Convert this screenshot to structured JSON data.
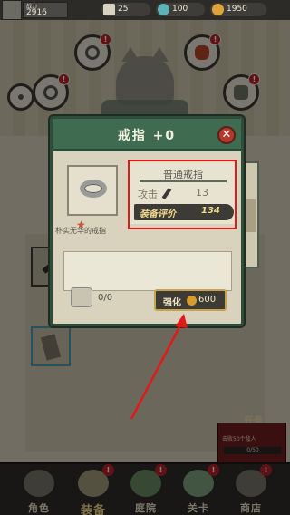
{
  "topbar": {
    "power_label": "战力",
    "power_value": "2916",
    "resource_1": "25",
    "resource_2": "100",
    "resource_3": "1950"
  },
  "slots": {
    "badge": "!"
  },
  "modal": {
    "title": "戒指 +0",
    "close_glyph": "✕",
    "item_name": "普通戒指",
    "attack_label": "攻击",
    "attack_value": "13",
    "score_label": "装备评价",
    "score_value": "134",
    "item_description": "朴实无华的戒指",
    "star_glyph": "★",
    "material_count": "0/0",
    "enhance_label": "强化",
    "enhance_cost": "600"
  },
  "mission": {
    "title": "任务",
    "text": "击败50个敌人",
    "progress": "0/50"
  },
  "nav": {
    "items": [
      {
        "label": "角色"
      },
      {
        "label": "装备"
      },
      {
        "label": "庭院"
      },
      {
        "label": "关卡"
      },
      {
        "label": "商店"
      }
    ],
    "badge": "!"
  },
  "colors": {
    "modal_header": "#3f6b50",
    "highlight": "#e11919",
    "badge": "#b9242a",
    "coin": "#d79b2e"
  },
  "icons": [
    "ring-icon",
    "sword-icon",
    "coin-icon",
    "close-icon",
    "star-icon",
    "gem-icon",
    "feather-icon"
  ]
}
